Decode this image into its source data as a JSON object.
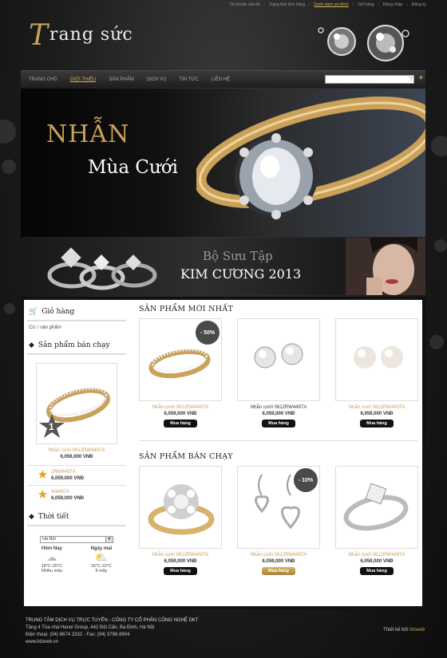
{
  "top_links": [
    "Tài khoản của tôi",
    "Trạng thái đơn hàng",
    "Danh sách ưa thích",
    "Giỏ hàng",
    "Đăng nhập",
    "Đăng ký"
  ],
  "top_links_active": 2,
  "logo": {
    "first": "T",
    "rest": "rang sức"
  },
  "nav": [
    "TRANG CHỦ",
    "GIỚI THIỆU",
    "SẢN PHẨM",
    "DỊCH VỤ",
    "TIN TỨC",
    "LIÊN HỆ"
  ],
  "nav_active": 1,
  "search": {
    "placeholder": ""
  },
  "banner1": {
    "line1": "NHẪN",
    "line2": "Mùa Cưới"
  },
  "banner2": {
    "line1": "Bộ Sưu Tập",
    "line2": "KIM CƯƠNG 2013"
  },
  "sidebar": {
    "cart_title": "Giỏ hàng",
    "cart_prefix": "Có",
    "cart_count": "0",
    "cart_suffix": "sản phẩm",
    "best_title": "Sản phẩm bán chạy",
    "best_rank": "1",
    "best_name": "Nhẫn cưới 0612RW4497A",
    "best_price": "6,059,000 VNĐ",
    "mini_items": [
      {
        "rank": "2",
        "name": "2RW4497A",
        "price": "6,059,000 VNĐ"
      },
      {
        "rank": "3",
        "name": "W4497A",
        "price": "6,059,000 VNĐ"
      }
    ],
    "weather_title": "Thời tiết",
    "weather_city": "Hà Nội",
    "weather": [
      {
        "day": "Hôm Nay",
        "temp": "18°C-20°C",
        "desc": "Nhiều mây"
      },
      {
        "day": "Ngày mai",
        "temp": "15°C-22°C",
        "desc": "Ít mây"
      }
    ]
  },
  "sections": [
    {
      "title": "SẢN PHẨM MỚI NHẤT",
      "products": [
        {
          "name": "Nhẫn cưới 0612RW4497A",
          "price": "6,059,000 VNĐ",
          "buy": "Mua hàng",
          "sale": "- 50%"
        },
        {
          "name": "Nhẫn cưới 0612RW4497A",
          "price": "6,059,000 VNĐ",
          "buy": "Mua hàng",
          "sale": ""
        },
        {
          "name": "Nhẫn cưới 0612RW4497A",
          "price": "6,059,000 VNĐ",
          "buy": "Mua hàng",
          "sale": ""
        }
      ]
    },
    {
      "title": "SẢN PHẨM BÁN CHẠY",
      "products": [
        {
          "name": "Nhẫn cưới 0612RW4497A",
          "price": "6,059,000 VNĐ",
          "buy": "Mua hàng",
          "sale": ""
        },
        {
          "name": "Nhẫn cưới 0612RW4497A",
          "price": "6,059,000 VNĐ",
          "buy": "Mua hàng",
          "sale": "- 10%"
        },
        {
          "name": "Nhẫn cưới 0612RW4497A",
          "price": "6,059,000 VNĐ",
          "buy": "Mua hàng",
          "sale": ""
        }
      ]
    }
  ],
  "footer": {
    "line1": "TRUNG TÂM DỊCH VỤ TRỰC TUYẾN -  CÔNG TY CỔ PHẦN CÔNG NGHỆ DKT",
    "line2": "Tầng 4 Tòa nhà Hanoi Group, 442 Đội Cấn, Ba Đình, Hà Nội",
    "line3": "Điện thoại: (04) 6674 2332 - Fax: (04) 3786 8904",
    "line4": "www.bizweb.vn",
    "designed_by": "Thiết kế bởi",
    "brand": "bizweb"
  }
}
